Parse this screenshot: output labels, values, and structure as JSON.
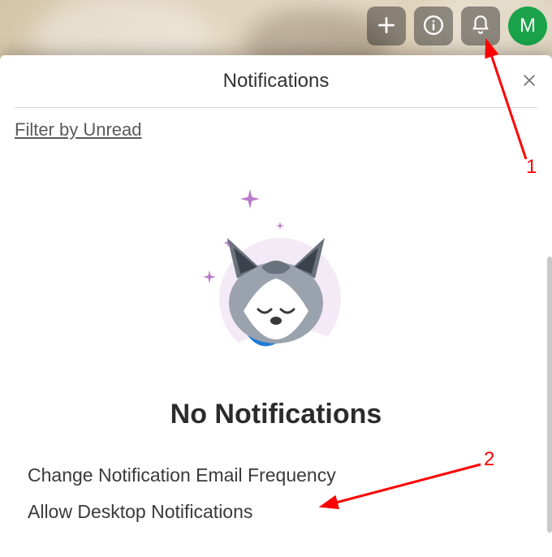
{
  "toolbar": {
    "add_tooltip": "Add",
    "info_tooltip": "Info",
    "notifications_tooltip": "Notifications",
    "avatar_initial": "M"
  },
  "panel": {
    "title": "Notifications",
    "filter_label": "Filter by Unread",
    "empty_heading": "No Notifications",
    "settings": {
      "change_email_freq": "Change Notification Email Frequency",
      "allow_desktop": "Allow Desktop Notifications"
    }
  },
  "annotations": {
    "a1": "1",
    "a2": "2"
  }
}
